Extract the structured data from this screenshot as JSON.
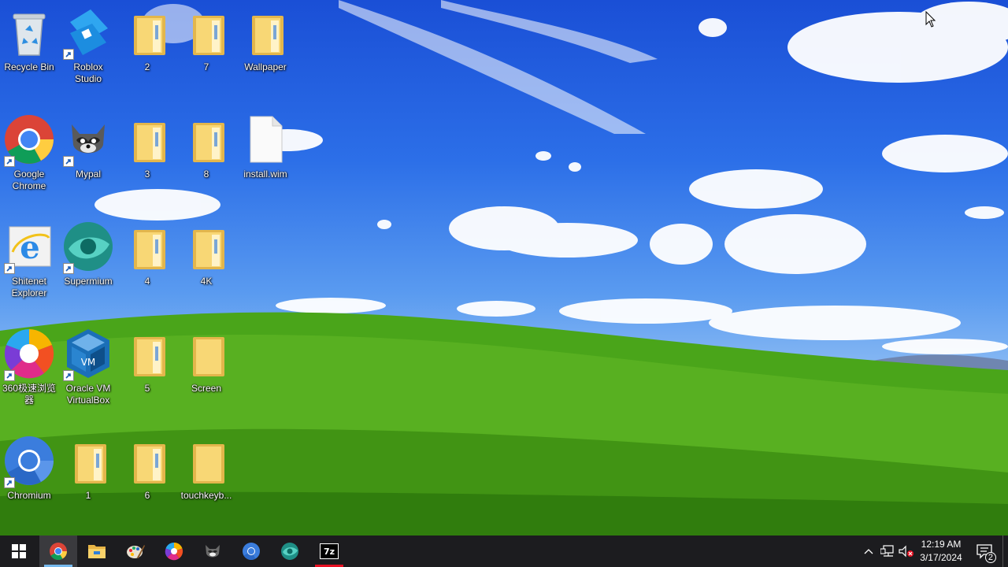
{
  "desktop": {
    "icons": [
      {
        "label": "Recycle Bin"
      },
      {
        "label": "Roblox Studio"
      },
      {
        "label": "2"
      },
      {
        "label": "7"
      },
      {
        "label": "Wallpaper"
      },
      {
        "label": "Google Chrome"
      },
      {
        "label": "Mypal"
      },
      {
        "label": "3"
      },
      {
        "label": "8"
      },
      {
        "label": "install.wim"
      },
      {
        "label": "Shitenet Explorer"
      },
      {
        "label": "Supermium"
      },
      {
        "label": "4"
      },
      {
        "label": "4K"
      },
      {
        "label": "360极速浏览器"
      },
      {
        "label": "Oracle VM VirtualBox"
      },
      {
        "label": "5"
      },
      {
        "label": "Screen"
      },
      {
        "label": "Chromium"
      },
      {
        "label": "1"
      },
      {
        "label": "6"
      },
      {
        "label": "touchkeyb..."
      }
    ]
  },
  "taskbar": {
    "apps": [
      {
        "icon": "chrome-icon",
        "active": true
      },
      {
        "icon": "file-explorer-icon"
      },
      {
        "icon": "paint-icon"
      },
      {
        "icon": "360-browser-icon"
      },
      {
        "icon": "mypal-icon"
      },
      {
        "icon": "chromium-icon"
      },
      {
        "icon": "supermium-icon"
      },
      {
        "icon": "7zip-icon",
        "text": "7z"
      }
    ],
    "clock": {
      "time": "12:19 AM",
      "date": "3/17/2024"
    },
    "notifications": {
      "count": "2"
    }
  }
}
